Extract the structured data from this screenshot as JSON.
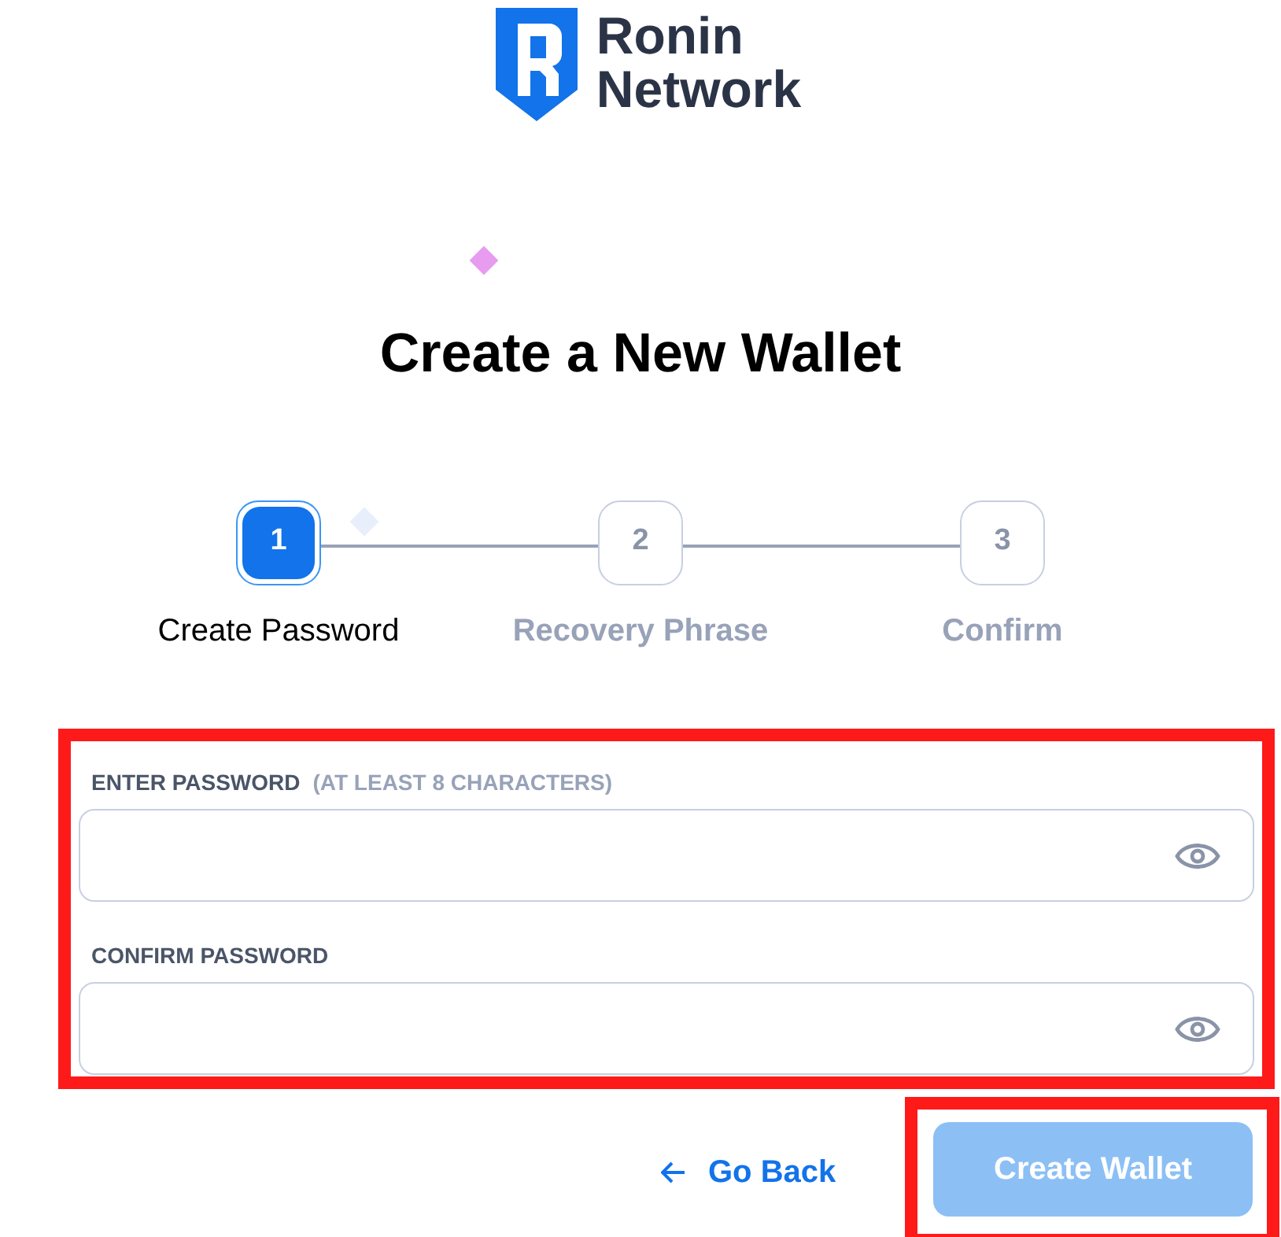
{
  "logo": {
    "line_1": "Ronin",
    "line_2": "Network"
  },
  "title": "Create a New Wallet",
  "steps": [
    {
      "number": "1",
      "label": "Create Password",
      "selected": true
    },
    {
      "number": "2",
      "label": "Recovery Phrase",
      "selected": false
    },
    {
      "number": "3",
      "label": "Confirm",
      "selected": false
    }
  ],
  "fields": [
    {
      "label": "ENTER PASSWORD",
      "hint": "(AT LEAST 8 CHARACTERS)"
    },
    {
      "label": "CONFIRM PASSWORD"
    }
  ],
  "buttons": {
    "back": "Go Back",
    "create": {
      "label": "Create Wallet",
      "disabled": true
    }
  }
}
